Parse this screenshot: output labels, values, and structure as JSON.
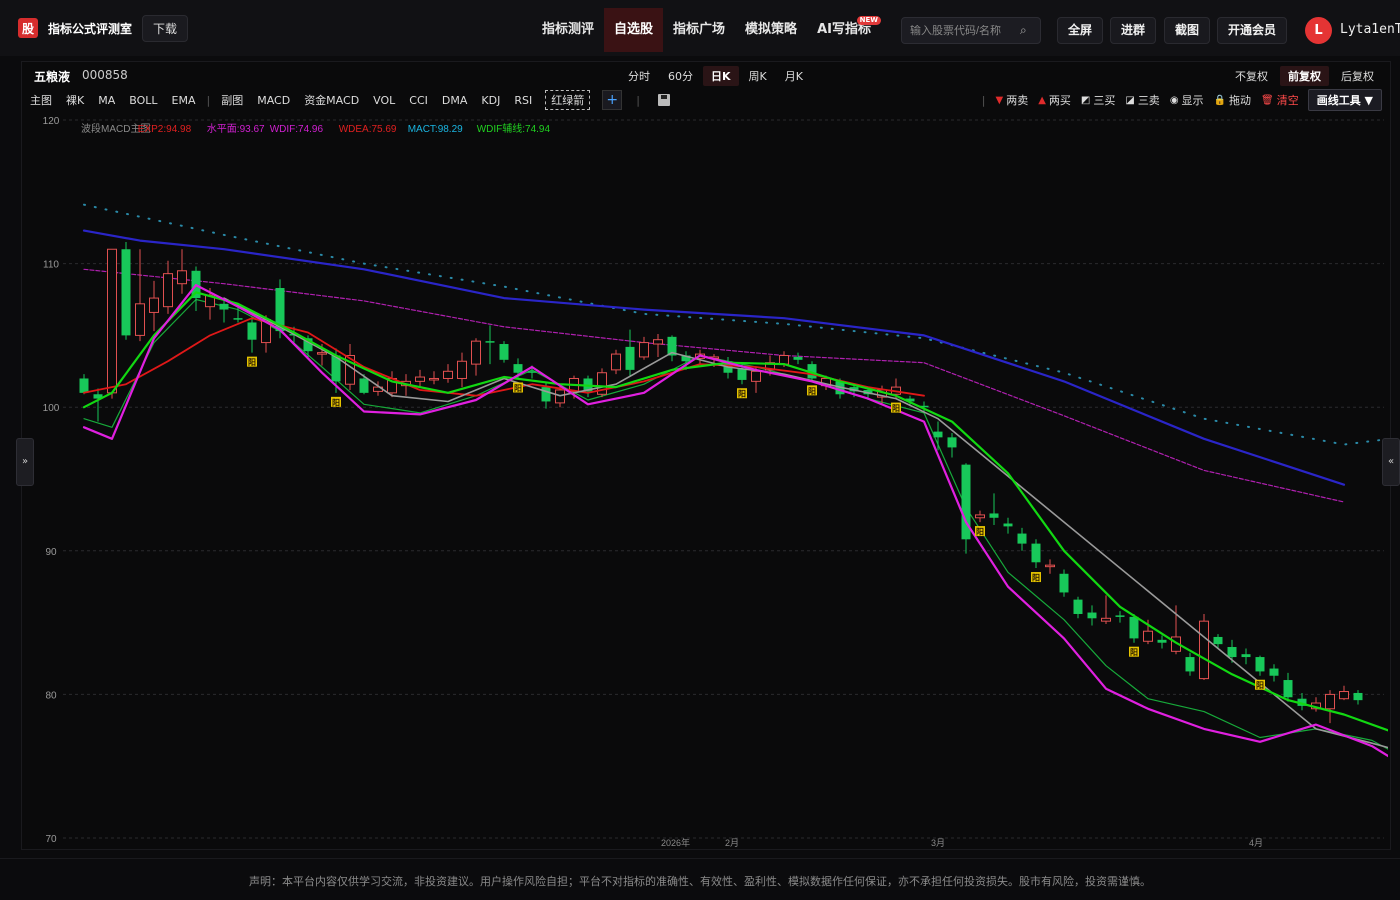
{
  "app": {
    "logo_text": "股",
    "title": "指标公式评测室",
    "download_label": "下载"
  },
  "nav": [
    {
      "label": "指标测评",
      "active": false
    },
    {
      "label": "自选股",
      "active": true
    },
    {
      "label": "指标广场",
      "active": false
    },
    {
      "label": "模拟策略",
      "active": false
    },
    {
      "label": "AI写指标",
      "active": false,
      "badge": "NEW"
    }
  ],
  "search": {
    "placeholder": "输入股票代码/名称",
    "value": "",
    "icon": "search-icon"
  },
  "top_buttons": [
    "全屏",
    "进群",
    "截图",
    "开通会员"
  ],
  "user": {
    "avatar_letter": "L",
    "name": "Lyta1enT"
  },
  "stock": {
    "name": "五粮液",
    "code": "000858"
  },
  "periods": [
    {
      "label": "分时",
      "active": false
    },
    {
      "label": "60分",
      "active": false
    },
    {
      "label": "日K",
      "active": true
    },
    {
      "label": "周K",
      "active": false
    },
    {
      "label": "月K",
      "active": false
    }
  ],
  "adjust": [
    {
      "label": "不复权",
      "active": false
    },
    {
      "label": "前复权",
      "active": true
    },
    {
      "label": "后复权",
      "active": false
    }
  ],
  "toolbar_left": [
    "主图",
    "裸K",
    "MA",
    "BOLL",
    "EMA",
    "|",
    "副图",
    "MACD",
    "资金MACD",
    "VOL",
    "CCI",
    "DMA",
    "KDJ",
    "RSI"
  ],
  "toolbar_dashed": "红绿箭",
  "toolbar_right": [
    {
      "label": "两卖",
      "icon": "down-triangle-icon",
      "color": "#e02b2b"
    },
    {
      "label": "两买",
      "icon": "up-triangle-icon",
      "color": "#e02b2b"
    },
    {
      "label": "三买",
      "icon": "chart-up-icon",
      "color": "#dddddd"
    },
    {
      "label": "三卖",
      "icon": "chart-down-icon",
      "color": "#dddddd"
    },
    {
      "label": "显示",
      "icon": "eye-icon",
      "color": "#dddddd"
    },
    {
      "label": "拖动",
      "icon": "lock-icon",
      "color": "#dddddd"
    },
    {
      "label": "清空",
      "icon": "trash-icon",
      "color": "#ff4a4a"
    }
  ],
  "draw_tool_label": "画线工具 ▼",
  "side_left": "»",
  "side_right": "«",
  "legend": [
    {
      "text": "波段MACD主图",
      "color": "#8a8a8a"
    },
    {
      "text": "EXP2:94.98",
      "color": "#e02020"
    },
    {
      "text": "水平面:93.67",
      "color": "#d020d0"
    },
    {
      "text": "WDIF:74.96",
      "color": "#d020d0"
    },
    {
      "text": "WDEA:75.69",
      "color": "#e02020"
    },
    {
      "text": "MACT:98.29",
      "color": "#1ab4e0"
    },
    {
      "text": "WDIF辅线:74.94",
      "color": "#20d020"
    }
  ],
  "colors": {
    "up": "#e05050",
    "down": "#18c85a",
    "blue_line": "#2a25c8",
    "dotted": "#2a8aa8",
    "purple_dash": "#b020b0"
  },
  "chart_data": {
    "type": "candlestick",
    "ylim": [
      70,
      120
    ],
    "yticks": [
      70,
      80,
      90,
      100,
      110,
      120
    ],
    "xlabels": [
      "2026年",
      "2月",
      "3月",
      "4月"
    ],
    "signal_label": "阳",
    "signal_indices": [
      12,
      18,
      31,
      47,
      52,
      58,
      64,
      68,
      75,
      84
    ],
    "candles": [
      [
        102.0,
        101.0,
        102.3,
        100.9
      ],
      [
        100.9,
        100.6,
        101.3,
        99.0
      ],
      [
        101.0,
        111.0,
        111.0,
        100.6
      ],
      [
        111.0,
        105.0,
        111.5,
        104.7
      ],
      [
        105.0,
        107.2,
        111.0,
        104.6
      ],
      [
        106.6,
        107.6,
        108.8,
        105.3
      ],
      [
        107.0,
        109.3,
        110.2,
        106.5
      ],
      [
        108.6,
        109.5,
        111.0,
        107.9
      ],
      [
        109.5,
        107.6,
        109.8,
        106.7
      ],
      [
        107.0,
        107.8,
        108.3,
        106.1
      ],
      [
        107.2,
        106.8,
        107.4,
        105.9
      ],
      [
        106.2,
        106.1,
        107.0,
        105.9
      ],
      [
        105.9,
        104.7,
        106.3,
        103.8
      ],
      [
        104.5,
        106.1,
        106.4,
        103.8
      ],
      [
        108.3,
        105.3,
        108.9,
        104.8
      ],
      [
        105.1,
        105.0,
        105.6,
        104.5
      ],
      [
        104.8,
        103.9,
        105.0,
        103.5
      ],
      [
        103.8,
        103.8,
        104.4,
        102.9
      ],
      [
        103.6,
        101.8,
        104.1,
        101.0
      ],
      [
        101.6,
        103.6,
        104.4,
        101.2
      ],
      [
        102.0,
        101.0,
        102.3,
        100.9
      ],
      [
        101.1,
        101.4,
        101.8,
        100.8
      ],
      [
        101.0,
        102.0,
        102.5,
        100.7
      ],
      [
        101.5,
        101.8,
        102.3,
        100.8
      ],
      [
        101.8,
        102.1,
        102.6,
        101.4
      ],
      [
        101.9,
        102.0,
        102.5,
        101.6
      ],
      [
        102.0,
        102.5,
        103.0,
        101.7
      ],
      [
        102.0,
        103.2,
        103.8,
        101.4
      ],
      [
        103.0,
        104.6,
        104.8,
        102.2
      ],
      [
        104.6,
        104.5,
        105.7,
        103.0
      ],
      [
        104.4,
        103.3,
        104.6,
        103.1
      ],
      [
        103.0,
        102.4,
        103.4,
        102.0
      ],
      [
        102.5,
        102.4,
        102.9,
        102.0
      ],
      [
        101.4,
        100.4,
        101.7,
        99.9
      ],
      [
        100.3,
        101.2,
        101.5,
        100.0
      ],
      [
        101.1,
        102.0,
        102.2,
        100.6
      ],
      [
        102.0,
        101.1,
        102.2,
        100.7
      ],
      [
        100.9,
        102.4,
        102.7,
        100.7
      ],
      [
        102.6,
        103.7,
        104.0,
        102.3
      ],
      [
        104.2,
        102.6,
        105.4,
        102.1
      ],
      [
        103.5,
        104.5,
        104.9,
        103.3
      ],
      [
        104.4,
        104.7,
        105.1,
        103.5
      ],
      [
        104.9,
        103.6,
        105.0,
        103.2
      ],
      [
        103.6,
        103.2,
        103.9,
        102.6
      ],
      [
        103.4,
        103.7,
        104.0,
        103.0
      ],
      [
        103.4,
        103.5,
        103.7,
        102.8
      ],
      [
        103.2,
        102.4,
        103.5,
        102.0
      ],
      [
        102.7,
        101.9,
        103.0,
        101.6
      ],
      [
        101.8,
        102.5,
        102.8,
        101.0
      ],
      [
        102.6,
        103.1,
        103.6,
        102.2
      ],
      [
        103.0,
        103.6,
        103.9,
        102.8
      ],
      [
        103.5,
        103.3,
        103.8,
        103.0
      ],
      [
        103.0,
        102.0,
        103.2,
        101.8
      ],
      [
        101.5,
        102.0,
        102.2,
        101.2
      ],
      [
        101.8,
        100.9,
        102.0,
        100.6
      ],
      [
        101.4,
        101.1,
        101.6,
        100.7
      ],
      [
        101.2,
        100.9,
        101.4,
        100.5
      ],
      [
        100.7,
        101.2,
        101.5,
        100.2
      ],
      [
        100.9,
        101.4,
        102.0,
        100.6
      ],
      [
        100.6,
        100.4,
        100.8,
        100.1
      ],
      [
        100.1,
        100.0,
        100.4,
        99.7
      ],
      [
        98.3,
        97.9,
        99.0,
        97.0
      ],
      [
        97.9,
        97.2,
        98.2,
        96.5
      ],
      [
        96.0,
        90.8,
        96.1,
        89.8
      ],
      [
        92.3,
        92.5,
        92.8,
        92.0
      ],
      [
        92.6,
        92.3,
        94.0,
        91.8
      ],
      [
        91.9,
        91.7,
        92.3,
        91.2
      ],
      [
        91.2,
        90.5,
        91.6,
        90.0
      ],
      [
        90.5,
        89.2,
        90.8,
        88.8
      ],
      [
        88.9,
        89.0,
        89.4,
        88.4
      ],
      [
        88.4,
        87.1,
        88.7,
        86.8
      ],
      [
        86.6,
        85.6,
        86.8,
        85.3
      ],
      [
        85.7,
        85.3,
        86.2,
        84.8
      ],
      [
        85.1,
        85.3,
        86.9,
        84.9
      ],
      [
        85.5,
        85.4,
        85.8,
        85.0
      ],
      [
        85.4,
        83.9,
        85.6,
        83.6
      ],
      [
        83.7,
        84.4,
        85.2,
        83.5
      ],
      [
        83.8,
        83.6,
        84.1,
        83.2
      ],
      [
        83.0,
        84.0,
        86.2,
        82.8
      ],
      [
        82.6,
        81.6,
        82.9,
        81.3
      ],
      [
        81.1,
        85.1,
        85.6,
        81.0
      ],
      [
        84.0,
        83.5,
        84.2,
        83.2
      ],
      [
        83.3,
        82.6,
        83.8,
        82.2
      ],
      [
        82.8,
        82.6,
        83.2,
        82.1
      ],
      [
        82.6,
        81.6,
        82.7,
        81.3
      ],
      [
        81.8,
        81.3,
        82.1,
        80.9
      ],
      [
        81.0,
        79.8,
        81.5,
        79.5
      ],
      [
        79.7,
        79.2,
        80.1,
        78.9
      ],
      [
        79.0,
        79.4,
        79.8,
        78.8
      ],
      [
        79.0,
        80.0,
        80.3,
        78.0
      ],
      [
        79.7,
        80.2,
        80.6,
        79.6
      ],
      [
        80.1,
        79.6,
        80.3,
        79.3
      ]
    ],
    "lines": {
      "blue": [
        [
          0,
          112.3
        ],
        [
          4,
          111.6
        ],
        [
          10,
          111.0
        ],
        [
          20,
          109.6
        ],
        [
          30,
          107.6
        ],
        [
          40,
          106.8
        ],
        [
          50,
          106.2
        ],
        [
          60,
          105.0
        ],
        [
          70,
          101.8
        ],
        [
          80,
          97.8
        ],
        [
          90,
          94.6
        ]
      ],
      "dotted": [
        [
          0,
          114.1
        ],
        [
          10,
          112.0
        ],
        [
          20,
          110.0
        ],
        [
          30,
          108.4
        ],
        [
          40,
          106.5
        ],
        [
          50,
          105.8
        ],
        [
          60,
          104.8
        ],
        [
          70,
          102.4
        ],
        [
          80,
          99.2
        ],
        [
          90,
          97.4
        ],
        [
          95,
          98.0
        ]
      ],
      "purple_dash": [
        [
          0,
          109.6
        ],
        [
          10,
          108.6
        ],
        [
          20,
          107.4
        ],
        [
          30,
          105.6
        ],
        [
          40,
          104.5
        ],
        [
          50,
          103.6
        ],
        [
          60,
          103.1
        ],
        [
          70,
          99.4
        ],
        [
          80,
          95.6
        ],
        [
          90,
          93.4
        ]
      ],
      "green_thick": [
        [
          0,
          100.0
        ],
        [
          2,
          101.0
        ],
        [
          5,
          105.0
        ],
        [
          8,
          108.0
        ],
        [
          11,
          107.2
        ],
        [
          15,
          105.2
        ],
        [
          18,
          103.6
        ],
        [
          22,
          101.8
        ],
        [
          26,
          101.0
        ],
        [
          30,
          102.1
        ],
        [
          34,
          101.6
        ],
        [
          38,
          101.4
        ],
        [
          42,
          102.6
        ],
        [
          46,
          103.1
        ],
        [
          50,
          103.0
        ],
        [
          54,
          101.8
        ],
        [
          58,
          100.8
        ],
        [
          62,
          99.0
        ],
        [
          66,
          95.4
        ],
        [
          70,
          90.0
        ],
        [
          74,
          86.1
        ],
        [
          78,
          83.6
        ],
        [
          82,
          81.4
        ],
        [
          86,
          79.6
        ],
        [
          90,
          78.6
        ],
        [
          94,
          77.2
        ],
        [
          98,
          75.8
        ]
      ],
      "green_thin": [
        [
          0,
          99.2
        ],
        [
          2,
          98.6
        ],
        [
          5,
          104.5
        ],
        [
          8,
          107.5
        ],
        [
          11,
          106.8
        ],
        [
          14,
          105.3
        ],
        [
          17,
          102.8
        ],
        [
          20,
          100.2
        ],
        [
          24,
          99.6
        ],
        [
          28,
          100.8
        ],
        [
          32,
          102.6
        ],
        [
          36,
          100.5
        ],
        [
          40,
          101.6
        ],
        [
          44,
          103.6
        ],
        [
          48,
          102.8
        ],
        [
          52,
          101.8
        ],
        [
          56,
          100.6
        ],
        [
          60,
          99.6
        ],
        [
          63,
          93.0
        ],
        [
          66,
          88.5
        ],
        [
          70,
          85.2
        ],
        [
          73,
          82.0
        ],
        [
          76,
          79.7
        ],
        [
          80,
          78.8
        ],
        [
          84,
          77.0
        ],
        [
          88,
          77.6
        ],
        [
          92,
          76.8
        ],
        [
          95,
          75.2
        ],
        [
          98,
          75.1
        ]
      ],
      "magenta": [
        [
          0,
          98.6
        ],
        [
          2,
          97.8
        ],
        [
          5,
          104.8
        ],
        [
          8,
          108.5
        ],
        [
          11,
          107.0
        ],
        [
          14,
          105.4
        ],
        [
          17,
          102.4
        ],
        [
          20,
          99.7
        ],
        [
          24,
          99.5
        ],
        [
          28,
          100.5
        ],
        [
          32,
          102.8
        ],
        [
          36,
          100.2
        ],
        [
          40,
          101.0
        ],
        [
          44,
          103.6
        ],
        [
          48,
          102.6
        ],
        [
          52,
          101.8
        ],
        [
          56,
          100.6
        ],
        [
          60,
          99.0
        ],
        [
          63,
          92.0
        ],
        [
          66,
          87.5
        ],
        [
          70,
          83.9
        ],
        [
          73,
          80.4
        ],
        [
          76,
          79.0
        ],
        [
          80,
          77.6
        ],
        [
          84,
          76.7
        ],
        [
          88,
          77.9
        ],
        [
          92,
          76.4
        ],
        [
          95,
          74.6
        ],
        [
          98,
          75.0
        ]
      ],
      "red": [
        [
          0,
          101.0
        ],
        [
          3,
          101.6
        ],
        [
          6,
          103.2
        ],
        [
          9,
          105.0
        ],
        [
          12,
          106.2
        ],
        [
          16,
          105.2
        ],
        [
          20,
          102.8
        ],
        [
          24,
          101.2
        ],
        [
          28,
          100.8
        ],
        [
          32,
          101.6
        ],
        [
          36,
          101.0
        ],
        [
          40,
          101.8
        ],
        [
          44,
          103.0
        ],
        [
          48,
          102.8
        ],
        [
          52,
          102.3
        ],
        [
          56,
          101.4
        ],
        [
          60,
          100.8
        ]
      ],
      "gray": [
        [
          10,
          107.6
        ],
        [
          14,
          105.6
        ],
        [
          18,
          103.5
        ],
        [
          22,
          100.8
        ],
        [
          26,
          100.4
        ],
        [
          30,
          102.0
        ],
        [
          34,
          100.8
        ],
        [
          38,
          101.6
        ],
        [
          42,
          103.8
        ],
        [
          46,
          102.8
        ],
        [
          50,
          102.3
        ],
        [
          54,
          101.4
        ],
        [
          58,
          100.6
        ],
        [
          61,
          99.2
        ],
        [
          88,
          77.6
        ],
        [
          92,
          76.6
        ],
        [
          98,
          75.0
        ]
      ]
    }
  },
  "footer": "声明：本平台内容仅供学习交流，非投资建议。用户操作风险自担；平台不对指标的准确性、有效性、盈利性、模拟数据作任何保证，亦不承担任何投资损失。股市有风险，投资需谨慎。"
}
